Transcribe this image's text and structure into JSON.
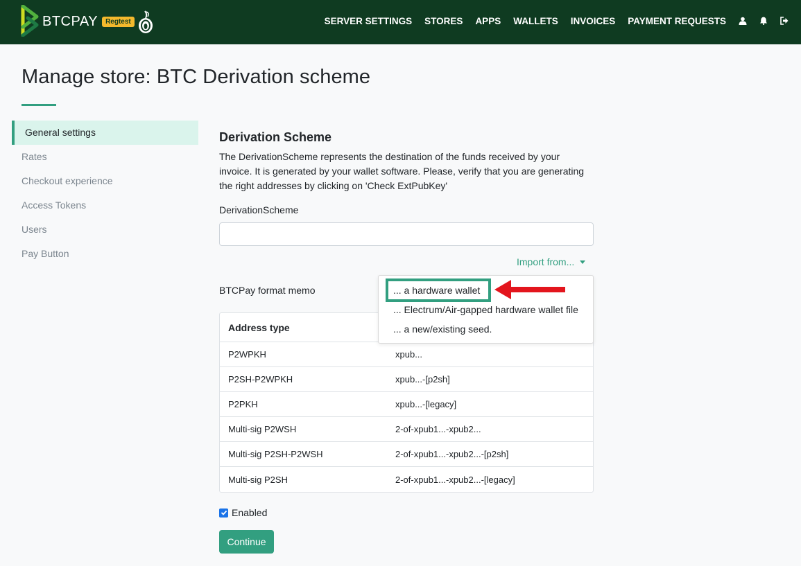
{
  "navbar": {
    "brand_text": "BTCPAY",
    "badge": "Regtest",
    "links": [
      "SERVER SETTINGS",
      "STORES",
      "APPS",
      "WALLETS",
      "INVOICES",
      "PAYMENT REQUESTS"
    ],
    "icons": [
      "user-icon",
      "bell-icon",
      "logout-icon"
    ],
    "bg_color": "#0f3b21"
  },
  "page": {
    "title": "Manage store: BTC Derivation scheme"
  },
  "sidebar": {
    "items": [
      {
        "label": "General settings",
        "active": true
      },
      {
        "label": "Rates"
      },
      {
        "label": "Checkout experience"
      },
      {
        "label": "Access Tokens"
      },
      {
        "label": "Users"
      },
      {
        "label": "Pay Button"
      }
    ]
  },
  "main": {
    "section_title": "Derivation Scheme",
    "description": "The DerivationScheme represents the destination of the funds received by your invoice. It is generated by your wallet software. Please, verify that you are generating the right addresses by clicking on 'Check ExtPubKey'",
    "field_label": "DerivationScheme",
    "field_value": "",
    "import_label": "Import from...",
    "memo_label": "BTCPay format memo",
    "dropdown": [
      "... a hardware wallet",
      "... Electrum/Air-gapped hardware wallet file",
      "... a new/existing seed."
    ],
    "table": {
      "header_type": "Address type",
      "rows": [
        {
          "type": "P2WPKH",
          "format": "xpub..."
        },
        {
          "type": "P2SH-P2WPKH",
          "format": "xpub...-[p2sh]"
        },
        {
          "type": "P2PKH",
          "format": "xpub...-[legacy]"
        },
        {
          "type": "Multi-sig P2WSH",
          "format": "2-of-xpub1...-xpub2..."
        },
        {
          "type": "Multi-sig P2SH-P2WSH",
          "format": "2-of-xpub1...-xpub2...-[p2sh]"
        },
        {
          "type": "Multi-sig P2SH",
          "format": "2-of-xpub1...-xpub2...-[legacy]"
        }
      ]
    },
    "enabled_label": "Enabled",
    "enabled_checked": true,
    "continue_label": "Continue"
  },
  "colors": {
    "accent": "#329f80",
    "arrow": "#e3151d"
  }
}
